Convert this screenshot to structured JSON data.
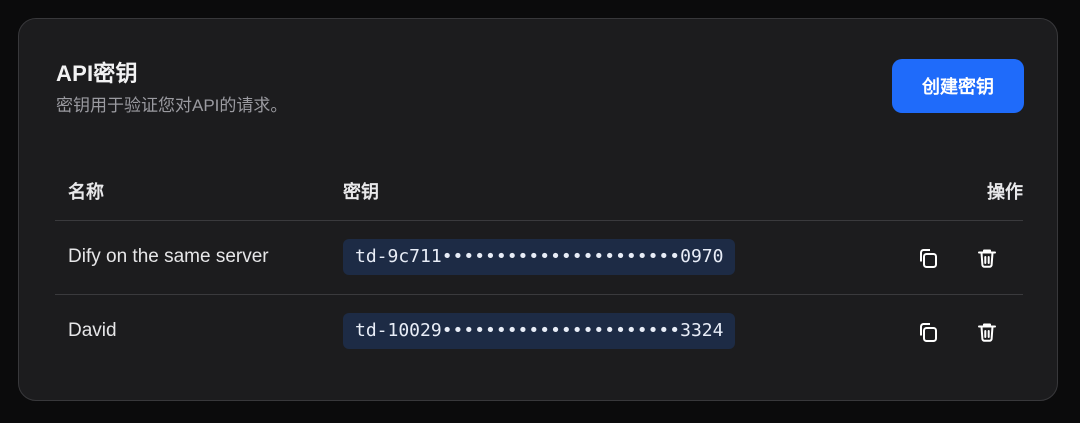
{
  "panel": {
    "title": "API密钥",
    "subtitle": "密钥用于验证您对API的请求。",
    "create_button_label": "创建密钥"
  },
  "table": {
    "columns": {
      "name": "名称",
      "key": "密钥",
      "actions": "操作"
    },
    "rows": [
      {
        "name": "Dify on the same server",
        "key": "td-9c711••••••••••••••••••••••0970",
        "copy_icon": "copy-icon",
        "delete_icon": "trash-icon"
      },
      {
        "name": "David",
        "key": "td-10029••••••••••••••••••••••3324",
        "copy_icon": "copy-icon",
        "delete_icon": "trash-icon"
      }
    ]
  },
  "colors": {
    "background": "#0b0b0c",
    "card": "#1c1c1e",
    "accent": "#1f6bfa",
    "key_pill": "#1d2b45"
  }
}
